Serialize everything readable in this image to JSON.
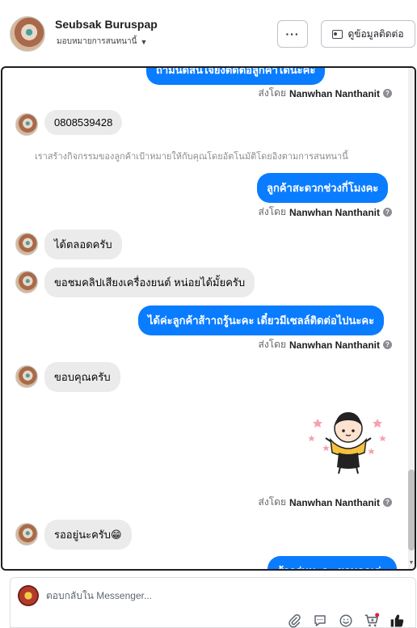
{
  "header": {
    "name": "Seubsak Buruspap",
    "assign_label": "มอบหมายการสนทนานี้",
    "more_label": "···",
    "contact_label": "ดูข้อมูลติดต่อ"
  },
  "chat": {
    "top_partial_message": "ถ้ามีนัดสนใจยังติดต่อลูกค้าได้นะคะ",
    "sent_by_prefix": "ส่งโดย",
    "agent_name": "Nanwhan Nanthanit",
    "help_glyph": "?",
    "messages": {
      "in_phone": "0808539428",
      "system_note": "เราสร้างกิจกรรมของลูกค้าเป้าหมายให้กับคุณโดยอัตโนมัติโดยอิงตามการสนทนานี้",
      "out_time": "ลูกค้าสะดวกช่วงกี่โมงคะ",
      "in_anytime": "ได้ตลอดครับ",
      "in_clip": "ขอชมคลิปเสียงเครื่องยนต์ หน่อยได้มั้ยครับ",
      "out_sales": "ได้ค่ะลูกค้าส้าาถรู้นะคะ เดี๋ยวมีเซลล์ติดต่อไปนะคะ",
      "in_thanks": "ขอบคุณครับ",
      "in_waiting": "รออยู่นะครับ😁",
      "bottom_partial_message": "ส้ากรุ่นนะคะ ขอบคุณค่ะ"
    }
  },
  "composer": {
    "placeholder": "ตอบกลับใน Messenger..."
  },
  "icons": {
    "attach": "paperclip-icon",
    "saved_reply": "chat-bubble-icon",
    "emoji": "smiley-icon",
    "cart": "cart-icon",
    "like": "thumbs-up-icon"
  },
  "colors": {
    "outgoing_bubble": "#0a7cff",
    "incoming_bubble": "#ebebeb",
    "cart_badge": "#e41e3f"
  }
}
